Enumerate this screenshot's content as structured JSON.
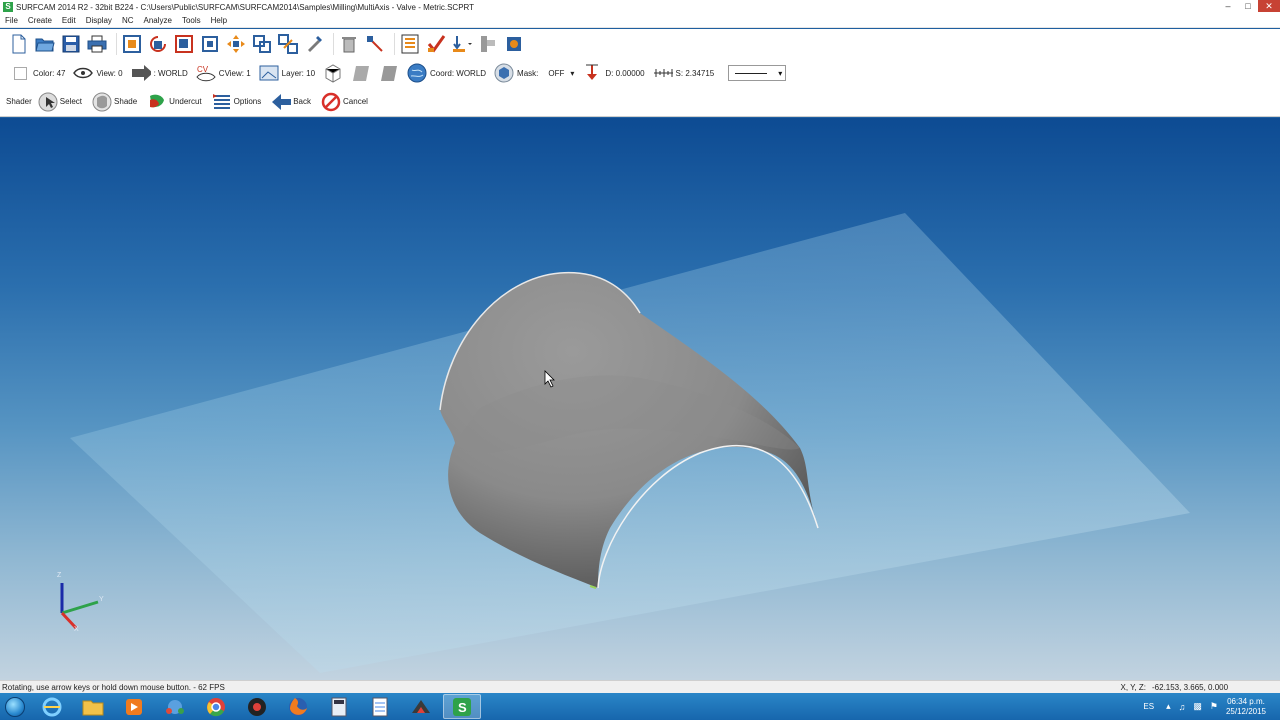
{
  "window": {
    "title": "SURFCAM 2014 R2 - 32bit B224 - C:\\Users\\Public\\SURFCAM\\SURFCAM2014\\Samples\\Milling\\MultiAxis - Valve - Metric.SCPRT",
    "app_letter": "S"
  },
  "menu": [
    "File",
    "Create",
    "Edit",
    "Display",
    "NC",
    "Analyze",
    "Tools",
    "Help"
  ],
  "status_toolbar": {
    "color": "Color: 47",
    "view": "View: 0",
    "cplane": ": WORLD",
    "cview": "CView: 1",
    "layer": "Layer: 10",
    "coord": "Coord: WORLD",
    "mask_label": "Mask:",
    "mask_value": "OFF",
    "depth": "D: 0.00000",
    "step": "S: 2.34715"
  },
  "command_toolbar": {
    "title": "Shader",
    "select": "Select",
    "shade": "Shade",
    "undercut": "Undercut",
    "options": "Options",
    "back": "Back",
    "cancel": "Cancel"
  },
  "triad": {
    "x": "X",
    "y": "Y",
    "z": "Z"
  },
  "statusbar": {
    "message": "Rotating, use arrow keys or hold down mouse button. - 62 FPS",
    "coords_label": "X, Y, Z:",
    "coords_value": "-62.153, 3.665, 0.000"
  },
  "taskbar": {
    "language": "ES",
    "time": "06:34 p.m.",
    "date": "25/12/2015"
  },
  "colors": {
    "viewport_top": "#0d4b93",
    "viewport_bottom": "#c2d3e0",
    "taskbar": "#1766ad",
    "active_app": "#2ea24a"
  }
}
